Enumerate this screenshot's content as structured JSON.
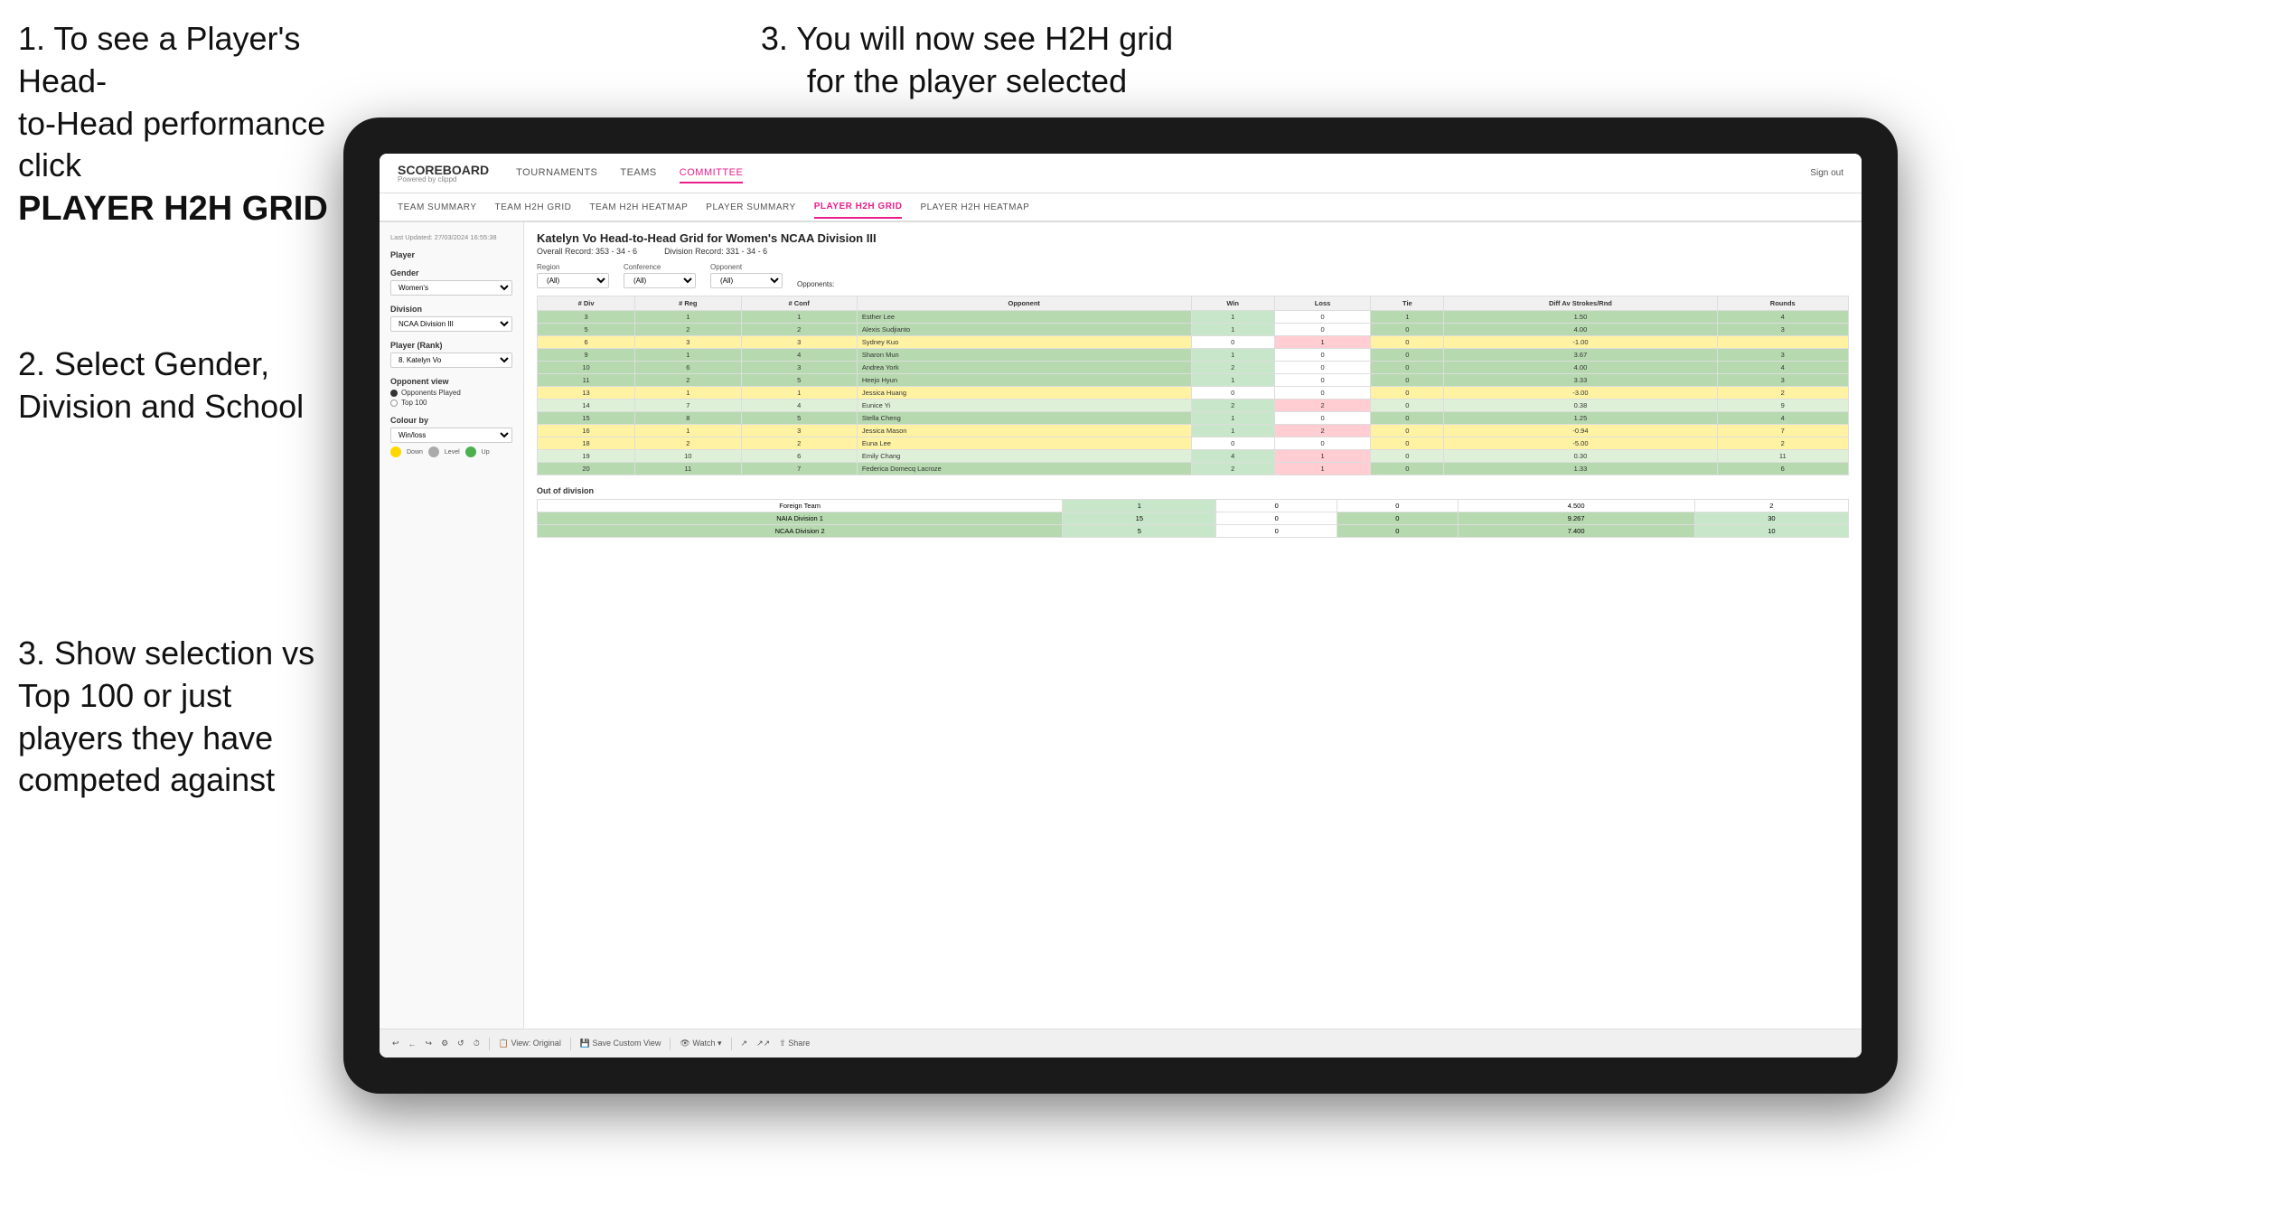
{
  "instructions": {
    "step1_line1": "1. To see a Player's Head-",
    "step1_line2": "to-Head performance click",
    "step1_bold": "PLAYER H2H GRID",
    "step2": "2. Select Gender, Division and School",
    "step3_top": "3. You will now see H2H grid for the player selected",
    "step3_bottom": "3. Show selection vs Top 100 or just players they have competed against"
  },
  "navbar": {
    "brand": "SCOREBOARD",
    "brand_sub": "Powered by clippd",
    "nav_items": [
      "TOURNAMENTS",
      "TEAMS",
      "COMMITTEE"
    ],
    "active_nav": "COMMITTEE",
    "sign_out": "Sign out"
  },
  "sub_navbar": {
    "items": [
      "TEAM SUMMARY",
      "TEAM H2H GRID",
      "TEAM H2H HEATMAP",
      "PLAYER SUMMARY",
      "PLAYER H2H GRID",
      "PLAYER H2H HEATMAP"
    ],
    "active": "PLAYER H2H GRID"
  },
  "sidebar": {
    "timestamp": "Last Updated: 27/03/2024 16:55:38",
    "player_label": "Player",
    "gender_label": "Gender",
    "gender_value": "Women's",
    "division_label": "Division",
    "division_value": "NCAA Division III",
    "player_rank_label": "Player (Rank)",
    "player_rank_value": "8. Katelyn Vo",
    "opponent_view_label": "Opponent view",
    "opponent_options": [
      "Opponents Played",
      "Top 100"
    ],
    "opponent_selected": "Opponents Played",
    "colour_by_label": "Colour by",
    "colour_value": "Win/loss",
    "legend": [
      {
        "color": "#ffd700",
        "label": "Down"
      },
      {
        "color": "#aaaaaa",
        "label": "Level"
      },
      {
        "color": "#4caf50",
        "label": "Up"
      }
    ]
  },
  "grid": {
    "title": "Katelyn Vo Head-to-Head Grid for Women's NCAA Division III",
    "overall_record": "Overall Record: 353 - 34 - 6",
    "division_record": "Division Record: 331 - 34 - 6",
    "filters": {
      "region_label": "Region",
      "conference_label": "Conference",
      "opponent_label": "Opponent",
      "opponents_label": "Opponents:",
      "region_value": "(All)",
      "conference_value": "(All)",
      "opponent_value": "(All)"
    },
    "table_headers": [
      "#",
      "#",
      "#",
      "Opponent",
      "Win",
      "Loss",
      "Tie",
      "Diff Av Strokes/Rnd",
      "Rounds"
    ],
    "table_sub_headers": [
      "Div",
      "Reg",
      "Conf"
    ],
    "rows": [
      {
        "div": "3",
        "reg": "1",
        "conf": "1",
        "opponent": "Esther Lee",
        "win": 1,
        "loss": 0,
        "tie": 1,
        "diff": "1.50",
        "rounds": 4,
        "color": "green"
      },
      {
        "div": "5",
        "reg": "2",
        "conf": "2",
        "opponent": "Alexis Sudjianto",
        "win": 1,
        "loss": 0,
        "tie": 0,
        "diff": "4.00",
        "rounds": 3,
        "color": "green"
      },
      {
        "div": "6",
        "reg": "3",
        "conf": "3",
        "opponent": "Sydney Kuo",
        "win": 0,
        "loss": 1,
        "tie": 0,
        "diff": "-1.00",
        "rounds": "",
        "color": "yellow"
      },
      {
        "div": "9",
        "reg": "1",
        "conf": "4",
        "opponent": "Sharon Mun",
        "win": 1,
        "loss": 0,
        "tie": 0,
        "diff": "3.67",
        "rounds": 3,
        "color": "green"
      },
      {
        "div": "10",
        "reg": "6",
        "conf": "3",
        "opponent": "Andrea York",
        "win": 2,
        "loss": 0,
        "tie": 0,
        "diff": "4.00",
        "rounds": 4,
        "color": "green"
      },
      {
        "div": "11",
        "reg": "2",
        "conf": "5",
        "opponent": "Heejo Hyun",
        "win": 1,
        "loss": 0,
        "tie": 0,
        "diff": "3.33",
        "rounds": 3,
        "color": "green"
      },
      {
        "div": "13",
        "reg": "1",
        "conf": "1",
        "opponent": "Jessica Huang",
        "win": 0,
        "loss": 0,
        "tie": 0,
        "diff": "-3.00",
        "rounds": 2,
        "color": "yellow"
      },
      {
        "div": "14",
        "reg": "7",
        "conf": "4",
        "opponent": "Eunice Yi",
        "win": 2,
        "loss": 2,
        "tie": 0,
        "diff": "0.38",
        "rounds": 9,
        "color": "light-green"
      },
      {
        "div": "15",
        "reg": "8",
        "conf": "5",
        "opponent": "Stella Cheng",
        "win": 1,
        "loss": 0,
        "tie": 0,
        "diff": "1.25",
        "rounds": 4,
        "color": "green"
      },
      {
        "div": "16",
        "reg": "1",
        "conf": "3",
        "opponent": "Jessica Mason",
        "win": 1,
        "loss": 2,
        "tie": 0,
        "diff": "-0.94",
        "rounds": 7,
        "color": "yellow"
      },
      {
        "div": "18",
        "reg": "2",
        "conf": "2",
        "opponent": "Euna Lee",
        "win": 0,
        "loss": 0,
        "tie": 0,
        "diff": "-5.00",
        "rounds": 2,
        "color": "yellow"
      },
      {
        "div": "19",
        "reg": "10",
        "conf": "6",
        "opponent": "Emily Chang",
        "win": 4,
        "loss": 1,
        "tie": 0,
        "diff": "0.30",
        "rounds": 11,
        "color": "light-green"
      },
      {
        "div": "20",
        "reg": "11",
        "conf": "7",
        "opponent": "Federica Domecq Lacroze",
        "win": 2,
        "loss": 1,
        "tie": 0,
        "diff": "1.33",
        "rounds": 6,
        "color": "green"
      }
    ],
    "out_of_division_label": "Out of division",
    "ood_rows": [
      {
        "name": "Foreign Team",
        "win": 1,
        "loss": 0,
        "tie": 0,
        "diff": "4.500",
        "rounds": 2,
        "color": "white"
      },
      {
        "name": "NAIA Division 1",
        "win": 15,
        "loss": 0,
        "tie": 0,
        "diff": "9.267",
        "rounds": 30,
        "color": "green"
      },
      {
        "name": "NCAA Division 2",
        "win": 5,
        "loss": 0,
        "tie": 0,
        "diff": "7.400",
        "rounds": 10,
        "color": "green"
      }
    ]
  },
  "toolbar": {
    "buttons": [
      "↩",
      "←",
      "↪",
      "⚙",
      "↩↪",
      "◌",
      "⏱",
      "View: Original",
      "Save Custom View",
      "Watch ▾",
      "↗",
      "↗↗",
      "Share"
    ]
  }
}
